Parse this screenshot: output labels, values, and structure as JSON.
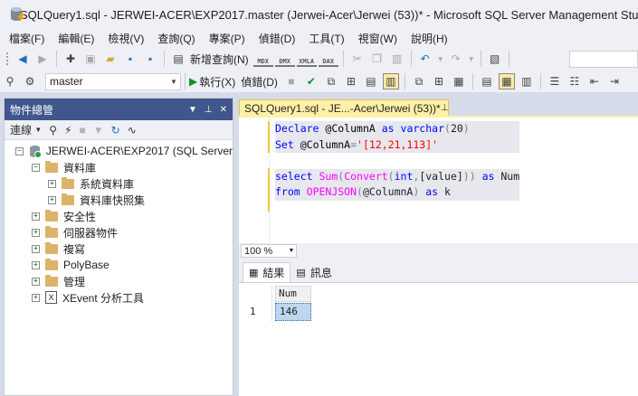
{
  "window": {
    "title": "SQLQuery1.sql - JERWEI-ACER\\EXP2017.master (Jerwei-Acer\\Jerwei (53))* - Microsoft SQL Server Management Studio"
  },
  "menu": [
    "檔案(F)",
    "編輯(E)",
    "檢視(V)",
    "查詢(Q)",
    "專案(P)",
    "偵錯(D)",
    "工具(T)",
    "視窗(W)",
    "說明(H)"
  ],
  "toolbar1": {
    "new_query_label": "新增查詢(N)",
    "mini_labels": [
      "MDX",
      "DMX",
      "XMLA",
      "DAX"
    ]
  },
  "toolbar2": {
    "database": "master",
    "execute_label": "執行(X)",
    "debug_label": "偵錯(D)"
  },
  "object_explorer": {
    "title": "物件總管",
    "connect_label": "連線",
    "server": "JERWEI-ACER\\EXP2017 (SQL Server",
    "nodes": {
      "databases": "資料庫",
      "system_databases": "系統資料庫",
      "snapshots": "資料庫快照集",
      "security": "安全性",
      "server_objects": "伺服器物件",
      "replication": "複寫",
      "polybase": "PolyBase",
      "management": "管理",
      "xevent": "XEvent 分析工具"
    }
  },
  "editor": {
    "tab_label": "SQLQuery1.sql - JE...-Acer\\Jerwei (53))*",
    "zoom": "100 %"
  },
  "results": {
    "tab_results": "結果",
    "tab_messages": "訊息",
    "columns": [
      "Num"
    ],
    "rows": [
      {
        "row_number": "1",
        "Num": "146"
      }
    ]
  }
}
